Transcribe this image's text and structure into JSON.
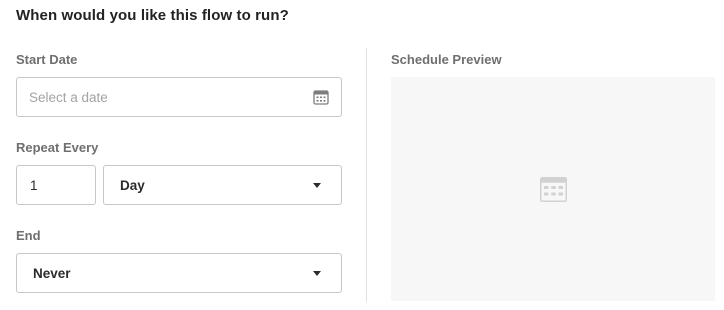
{
  "heading": "When would you like this flow to run?",
  "start_date": {
    "label": "Start Date",
    "placeholder": "Select a date",
    "icon": "calendar-icon"
  },
  "repeat": {
    "label": "Repeat Every",
    "interval_value": "1",
    "unit_value": "Day",
    "icon": "chevron-down-icon"
  },
  "end": {
    "label": "End",
    "value": "Never",
    "icon": "chevron-down-icon"
  },
  "preview": {
    "label": "Schedule Preview",
    "icon": "calendar-icon"
  },
  "colors": {
    "panel_background": "#f7f7f7",
    "border": "#c7c7c7",
    "label_text": "#6f6f6f",
    "placeholder_text": "#a3a3a3"
  }
}
